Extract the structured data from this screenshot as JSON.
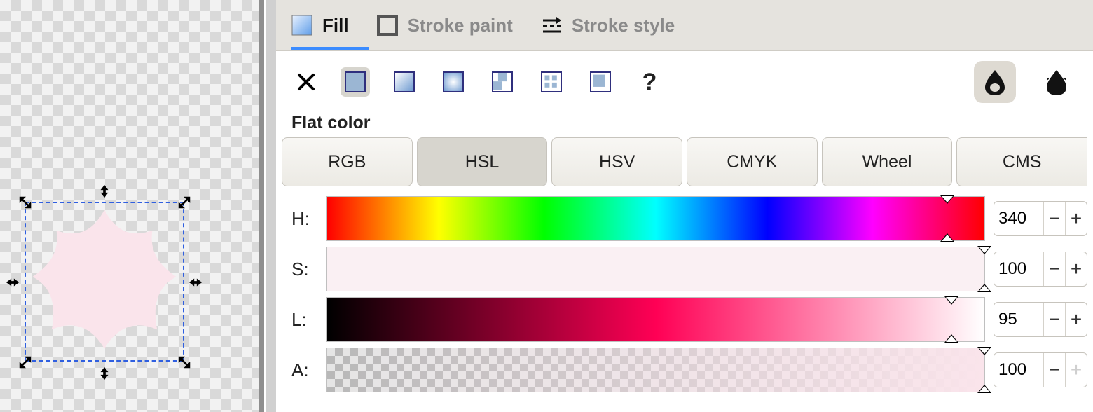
{
  "tabs": {
    "fill": "Fill",
    "stroke_paint": "Stroke paint",
    "stroke_style": "Stroke style",
    "active": "fill"
  },
  "paint_type": {
    "section_label": "Flat color",
    "none_icon": "x-icon",
    "flat_icon": "flat-color-icon",
    "linear_icon": "linear-gradient-icon",
    "radial_icon": "radial-gradient-icon",
    "pattern_icon": "pattern-icon",
    "mesh_icon": "mesh-gradient-icon",
    "swatch_icon": "swatch-icon",
    "unknown_icon": "unknown-paint-icon"
  },
  "color_modes": {
    "rgb": "RGB",
    "hsl": "HSL",
    "hsv": "HSV",
    "cmyk": "CMYK",
    "wheel": "Wheel",
    "cms": "CMS",
    "active": "hsl"
  },
  "hsl": {
    "h_label": "H:",
    "s_label": "S:",
    "l_label": "L:",
    "a_label": "A:",
    "h": "340",
    "s": "100",
    "l": "95",
    "a": "100"
  },
  "canvas": {
    "shape_fill": "#fae4eb"
  },
  "icons": {
    "question": "?",
    "minus": "−",
    "plus": "+"
  }
}
